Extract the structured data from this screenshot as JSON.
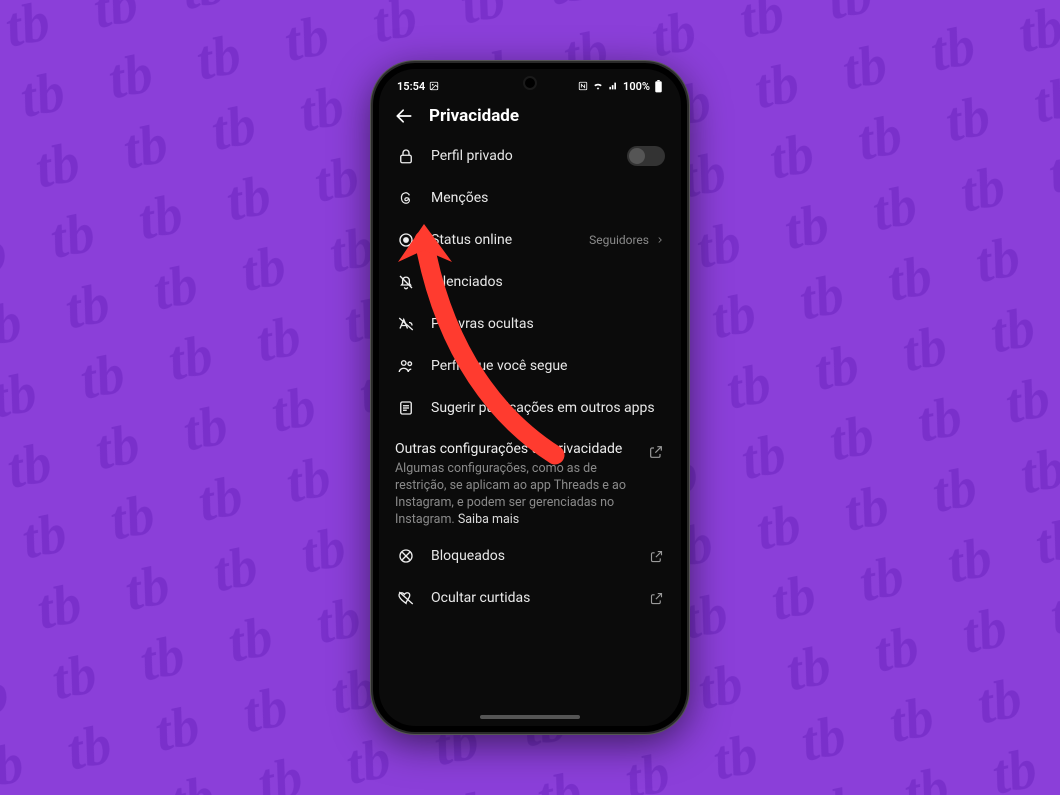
{
  "statusbar": {
    "time": "15:54",
    "battery_label": "100%"
  },
  "header": {
    "title": "Privacidade"
  },
  "list": {
    "private_profile": {
      "label": "Perfil privado"
    },
    "mentions": {
      "label": "Menções"
    },
    "online_status": {
      "label": "Status online",
      "value": "Seguidores"
    },
    "muted": {
      "label": "Silenciados"
    },
    "hidden_words": {
      "label": "Palavras ocultas"
    },
    "profiles_follow": {
      "label": "Perfis que você segue"
    },
    "suggest_posts": {
      "label": "Sugerir publicações em outros apps"
    }
  },
  "section": {
    "heading": "Outras configurações de privacidade",
    "desc": "Algumas configurações, como as de restrição, se aplicam ao app Threads e ao Instagram, e podem ser gerenciadas no Instagram.",
    "more": "Saiba mais"
  },
  "list2": {
    "blocked": {
      "label": "Bloqueados"
    },
    "hide_likes": {
      "label": "Ocultar curtidas"
    }
  }
}
